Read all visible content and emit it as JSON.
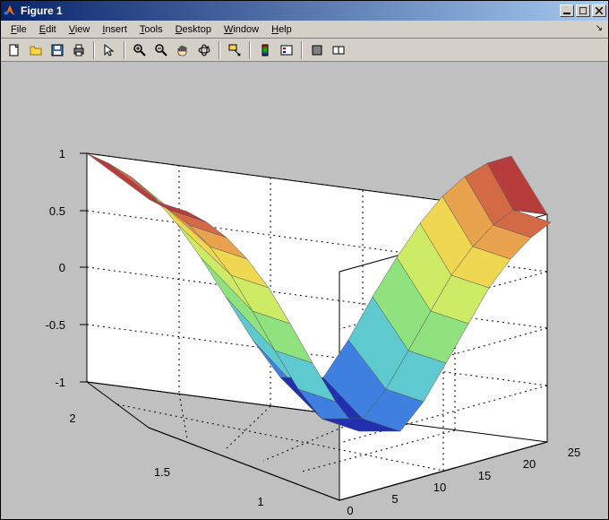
{
  "window": {
    "title": "Figure 1"
  },
  "menu": {
    "file": "File",
    "edit": "Edit",
    "view": "View",
    "insert": "Insert",
    "tools": "Tools",
    "desktop": "Desktop",
    "window": "Window",
    "help": "Help"
  },
  "toolbar_icons": {
    "new": "new-file",
    "open": "open-file",
    "save": "save",
    "print": "print",
    "pointer": "pointer",
    "zoom_in": "zoom-in",
    "zoom_out": "zoom-out",
    "pan": "pan",
    "rotate": "rotate-3d",
    "dataCursor": "data-cursor",
    "colorbar": "insert-colorbar",
    "legend": "insert-legend",
    "hide": "hide-tools",
    "dock": "dock"
  },
  "axes": {
    "z_ticks": [
      "-1",
      "-0.5",
      "0",
      "0.5",
      "1"
    ],
    "y_ticks": [
      "1",
      "1.5",
      "2"
    ],
    "x_ticks": [
      "0",
      "5",
      "10",
      "15",
      "20",
      "25"
    ]
  },
  "chart_data": {
    "type": "surface",
    "description": "3-D cylindrical surface z(x,y) = cos(x * 2*pi / 25), colored by z (jet colormap)",
    "x_range": [
      0,
      25
    ],
    "y_range": [
      1,
      2
    ],
    "z_range": [
      -1,
      1
    ],
    "x_samples": [
      0,
      2.5,
      5,
      7.5,
      10,
      12.5,
      15,
      17.5,
      20,
      22.5,
      25
    ],
    "z_values": [
      1.0,
      0.809,
      0.309,
      -0.309,
      -0.809,
      -1.0,
      -0.809,
      -0.309,
      0.309,
      0.809,
      1.0
    ],
    "xlabel": "",
    "ylabel": "",
    "zlabel": "",
    "colormap": "jet",
    "grid": true,
    "view_az": -37.5,
    "view_el": 30
  }
}
